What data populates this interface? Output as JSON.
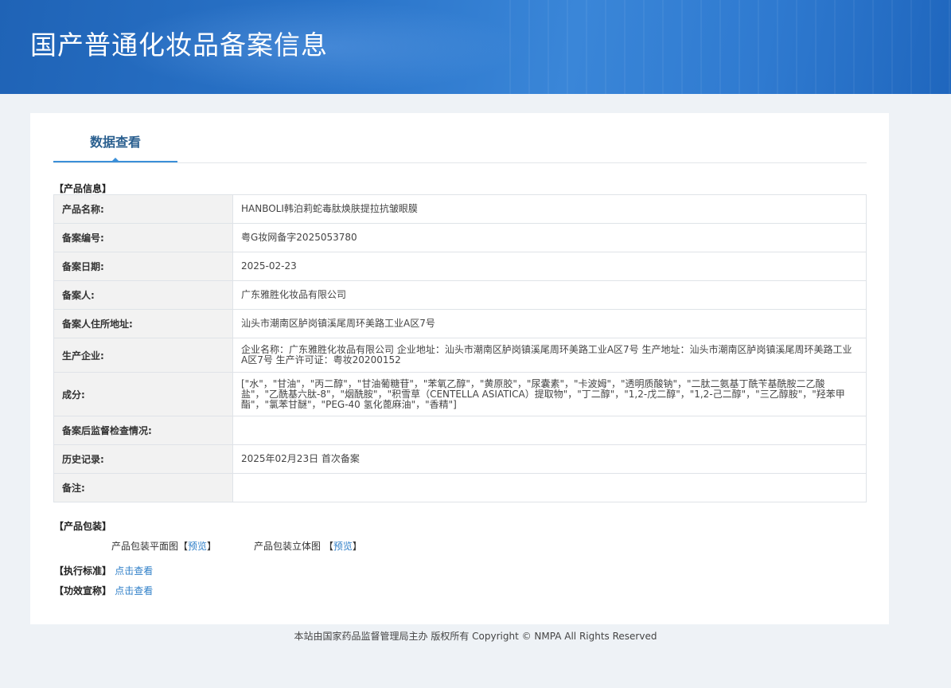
{
  "header": {
    "title": "国产普通化妆品备案信息"
  },
  "tab": {
    "label": "数据查看"
  },
  "product_info": {
    "section_title": "【产品信息】",
    "rows": [
      {
        "label": "产品名称:",
        "value": "HANBOLI韩泊莉蛇毒肽焕肤提拉抗皱眼膜"
      },
      {
        "label": "备案编号:",
        "value": "粤G妆网备字2025053780"
      },
      {
        "label": "备案日期:",
        "value": "2025-02-23"
      },
      {
        "label": "备案人:",
        "value": "广东雅胜化妆品有限公司"
      },
      {
        "label": "备案人住所地址:",
        "value": "汕头市潮南区胪岗镇溪尾周环美路工业A区7号"
      },
      {
        "label": "生产企业:",
        "value": "企业名称：广东雅胜化妆品有限公司 企业地址：汕头市潮南区胪岗镇溪尾周环美路工业A区7号 生产地址：汕头市潮南区胪岗镇溪尾周环美路工业A区7号 生产许可证：粤妆20200152"
      },
      {
        "label": "成分:",
        "value": "[\"水\"，\"甘油\"，\"丙二醇\"，\"甘油葡糖苷\"，\"苯氧乙醇\"，\"黄原胶\"，\"尿囊素\"，\"卡波姆\"，\"透明质酸钠\"，\"二肽二氨基丁酰苄基酰胺二乙酸盐\"，\"乙酰基六肽-8\"，\"烟酰胺\"，\"积雪草（CENTELLA ASIATICA）提取物\"，\"丁二醇\"，\"1,2-戊二醇\"，\"1,2-己二醇\"，\"三乙醇胺\"，\"羟苯甲酯\"，\"氯苯甘醚\"，\"PEG-40 氢化蓖麻油\"，\"香精\"]"
      },
      {
        "label": "备案后监督检查情况:",
        "value": ""
      },
      {
        "label": "历史记录:",
        "value": "2025年02月23日 首次备案"
      },
      {
        "label": "备注:",
        "value": ""
      }
    ]
  },
  "packaging": {
    "section_title": "【产品包装】",
    "flat_label": "产品包装平面图",
    "solid_label": "产品包装立体图",
    "bracket_open": "【",
    "bracket_close": "】",
    "preview_link": "预览"
  },
  "standard": {
    "section_title": "【执行标准】",
    "link": "点击查看"
  },
  "efficacy": {
    "section_title": "【功效宣称】",
    "link": "点击查看"
  },
  "footer": {
    "text": "本站由国家药品监督管理局主办 版权所有 Copyright © NMPA All Rights Reserved"
  }
}
